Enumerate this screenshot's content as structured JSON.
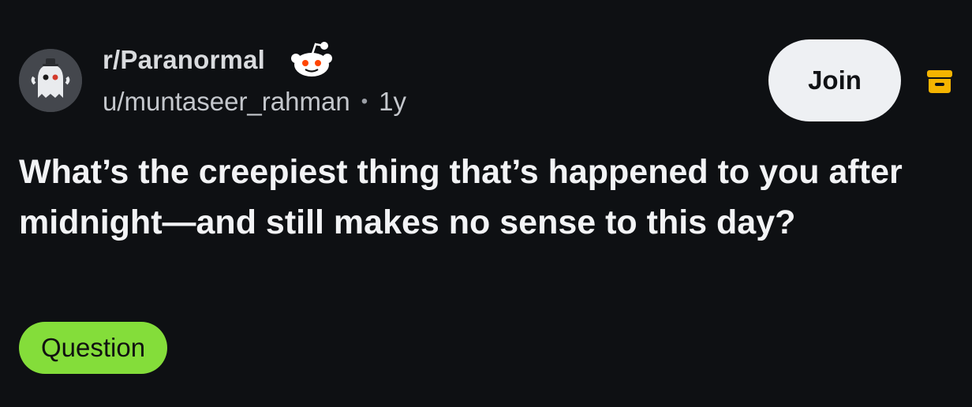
{
  "post": {
    "subreddit": "r/Paranormal",
    "author": "u/muntaseer_rahman",
    "separator": "•",
    "age": "1y",
    "join_label": "Join",
    "title": "What’s the creepiest thing that’s happened to you after midnight—and still makes no sense to this day?",
    "flair": "Question"
  },
  "icons": {
    "avatar": "ghost-avatar-icon",
    "badge": "reddit-snoo-icon",
    "archive": "archive-icon"
  },
  "colors": {
    "background": "#0e1013",
    "join_button_bg": "#eef0f3",
    "flair_bg": "#84dd3a",
    "archive_icon": "#f5b400",
    "snoo_eyes": "#ff4500"
  }
}
